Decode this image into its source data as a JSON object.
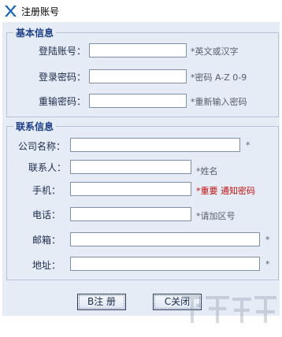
{
  "window": {
    "title": "注册账号"
  },
  "basic_info": {
    "group_title": "基本信息",
    "account_label": "登陆账号：",
    "account_hint": "*英文或汉字",
    "password_label": "登录密码：",
    "password_hint": "*密码 A-Z 0-9",
    "confirm_label": "重输密码：",
    "confirm_hint": "*重新输入密码"
  },
  "contact_info": {
    "group_title": "联系信息",
    "company_label": "公司名称：",
    "company_hint": "*",
    "contact_label": "联系人：",
    "contact_hint": "*姓名",
    "mobile_label": "手机：",
    "mobile_hint": "*重要 通知密码",
    "phone_label": "电话：",
    "phone_hint": "*请加区号",
    "email_label": "邮箱：",
    "email_hint": "*",
    "address_label": "地址：",
    "address_hint": "*"
  },
  "buttons": {
    "register_label": "B注 册",
    "close_label": "C关闭"
  },
  "colors": {
    "client_bg": "#e6ecf5",
    "group_title": "#1b3f8b",
    "warning_hint": "#c41010"
  },
  "icons": {
    "app": "app-logo-icon"
  }
}
